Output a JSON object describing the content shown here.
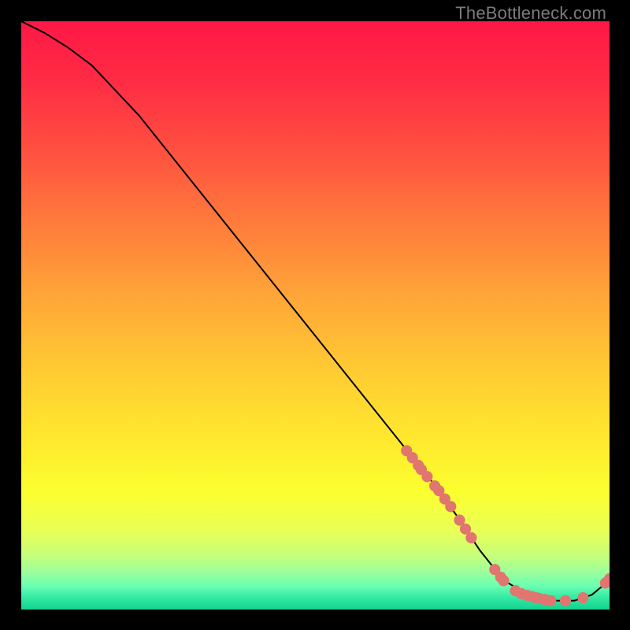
{
  "watermark": "TheBottleneck.com",
  "gradient_stops": [
    {
      "offset": 0.0,
      "color": "#ff1846"
    },
    {
      "offset": 0.1,
      "color": "#ff2b44"
    },
    {
      "offset": 0.22,
      "color": "#ff5040"
    },
    {
      "offset": 0.34,
      "color": "#ff7a3c"
    },
    {
      "offset": 0.46,
      "color": "#ffa338"
    },
    {
      "offset": 0.58,
      "color": "#ffc733"
    },
    {
      "offset": 0.7,
      "color": "#ffe62e"
    },
    {
      "offset": 0.8,
      "color": "#fbff2f"
    },
    {
      "offset": 0.865,
      "color": "#e9ff55"
    },
    {
      "offset": 0.905,
      "color": "#c9ff77"
    },
    {
      "offset": 0.935,
      "color": "#9fff9b"
    },
    {
      "offset": 0.96,
      "color": "#6affb2"
    },
    {
      "offset": 0.98,
      "color": "#33e9a4"
    },
    {
      "offset": 1.0,
      "color": "#11d28d"
    }
  ],
  "chart_data": {
    "type": "line",
    "title": "",
    "xlabel": "",
    "ylabel": "",
    "xlim": [
      0,
      100
    ],
    "ylim": [
      0,
      100
    ],
    "x": [
      0,
      4,
      8,
      12,
      20,
      30,
      40,
      50,
      60,
      66,
      70,
      74,
      78,
      82,
      86,
      90,
      94,
      97,
      100
    ],
    "y": [
      100,
      98,
      95.5,
      92.5,
      84,
      71.5,
      59,
      46.5,
      34,
      26.5,
      21.5,
      16,
      10,
      5,
      2.5,
      1.5,
      1.5,
      2.5,
      5
    ],
    "markers": [
      {
        "x": 65.5,
        "y": 27.0
      },
      {
        "x": 66.5,
        "y": 25.8
      },
      {
        "x": 67.5,
        "y": 24.5
      },
      {
        "x": 68.0,
        "y": 23.8
      },
      {
        "x": 69.0,
        "y": 22.6
      },
      {
        "x": 70.3,
        "y": 21.0
      },
      {
        "x": 71.0,
        "y": 20.2
      },
      {
        "x": 72.0,
        "y": 18.8
      },
      {
        "x": 73.0,
        "y": 17.5
      },
      {
        "x": 74.5,
        "y": 15.2
      },
      {
        "x": 75.5,
        "y": 13.7
      },
      {
        "x": 76.5,
        "y": 12.2
      },
      {
        "x": 80.5,
        "y": 6.8
      },
      {
        "x": 81.5,
        "y": 5.5
      },
      {
        "x": 82.0,
        "y": 4.9
      },
      {
        "x": 84.0,
        "y": 3.2
      },
      {
        "x": 85.0,
        "y": 2.7
      },
      {
        "x": 86.0,
        "y": 2.4
      },
      {
        "x": 86.8,
        "y": 2.2
      },
      {
        "x": 87.5,
        "y": 2.0
      },
      {
        "x": 88.0,
        "y": 1.9
      },
      {
        "x": 89.0,
        "y": 1.7
      },
      {
        "x": 90.0,
        "y": 1.5
      },
      {
        "x": 92.5,
        "y": 1.5
      },
      {
        "x": 95.5,
        "y": 2.0
      },
      {
        "x": 99.3,
        "y": 4.5
      },
      {
        "x": 100.0,
        "y": 5.2
      }
    ],
    "marker_color": "#e0766f",
    "line_color": "#000000"
  }
}
